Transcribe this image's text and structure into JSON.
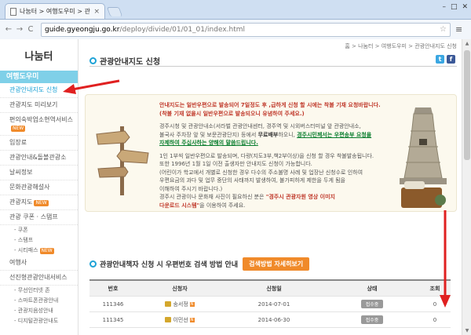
{
  "browser": {
    "tab_title": "나눔터 > 여행도우미 > 관",
    "tab_close": "×",
    "url_host": "guide.gyeongju.go.kr",
    "url_path": "/deploy/divide/01/01_01/index.html",
    "win_min": "–",
    "win_max": "□",
    "win_close": "✕",
    "back": "←",
    "forward": "→",
    "reload": "C",
    "star": "☆",
    "menu": "≡"
  },
  "sidebar": {
    "site_title": "나눔터",
    "header": "여행도우미",
    "items": [
      {
        "label": "관광안내지도 신청",
        "active": true
      },
      {
        "label": "관광지도 미리보기"
      },
      {
        "label": "편의숙박업소현역서비스",
        "new": "NEW"
      },
      {
        "label": "입장료"
      },
      {
        "label": "관광안내&돌볼관광소"
      },
      {
        "label": "날씨정보"
      },
      {
        "label": "문화관광해설사"
      },
      {
        "label": "관광지도",
        "new": "NEW"
      },
      {
        "label": "관광 쿠폰 · 스탬프"
      }
    ],
    "subitems": [
      "쿠폰",
      "스탬프",
      "시티패스"
    ],
    "subitem_new": "NEW",
    "items2": [
      {
        "label": "여행사"
      },
      {
        "label": "선진형관광안내서비스"
      }
    ],
    "subitems2": [
      "무선인터넷 존",
      "스마트폰관광안내",
      "관광지음성안내",
      "디지털관광안내도"
    ]
  },
  "main": {
    "breadcrumb": "홈 > 나눔터 > 여행도우미 > 관광안내지도 신청",
    "page_title": "관광안내지도 신청",
    "sns_twitter": "t",
    "sns_facebook": "f",
    "info": {
      "p1": "안내지도는 일반우편으로 발송되어 7일정도 후 ,급하게 신청 할 시에는 착불 기재 요청바랍니다.",
      "p1b": "(착불 기재 없을시 일반우편으로 발송되오니 유념하여 주세요.)",
      "p2a": "경주시청 및 관광안내소(서라벌 관광안내센터, 경주역 및 시외버스터미널 앞 관광안내소,",
      "p2b": "불국사 주차장 앞 및 보문관광단지) 등에서 ",
      "p2_free": "무료배부",
      "p2c": "하오니, ",
      "p2_hl": "경주시민께서는 우편송부 요청을",
      "p2_hl2": "자제하여 주십사하는 양해의 말씀드립니다.",
      "p3": "1인 1부씩 일반우편으로 발송되며, 다량(지도3부,책2부이상)을 신청 할 경우 착불발송됩니다.",
      "p4": "또한 1996년 1월 1일 이전 출생자만 안내지도 신청이 가능합니다.",
      "p5": "(어린이가 학교에서 개별로 신청한 경우 다수의 주소불명 사례 및 업장난 신청수로 인하여",
      "p6": "우편요금의 과다 및 업무 중단의 사태까지 발생하여, 불가피하게 제한을 두게 됨을",
      "p7": "이해하여 주시기 바랍니다.)",
      "p8a": "경주시 관광이나 문화재 사진이 필요하신 분은 ",
      "p8_hl": "\"경주시 관광자원 영상 이미지",
      "p8_hl2": "다운로드 시스템\"",
      "p8b": "을 이용하여 주세요."
    },
    "section2_title": "관광안내책자 신청 시 우편번호 검색 방법 안내",
    "help_button": "검색방법 자세히보기",
    "table": {
      "headers": [
        "번호",
        "신청자",
        "신청일",
        "상태",
        "조회"
      ],
      "rows": [
        {
          "no": "111346",
          "name": "송서정",
          "date": "2014-07-01",
          "status": "접수중",
          "views": "0"
        },
        {
          "no": "111345",
          "name": "이민선",
          "date": "2014-06-30",
          "status": "접수중",
          "views": "0"
        }
      ],
      "name_badge": "N"
    }
  },
  "colors": {
    "accent": "#1da2d6",
    "nav_header": "#7fd0e8",
    "orange": "#f08a2a",
    "annotation": "#e02020"
  }
}
